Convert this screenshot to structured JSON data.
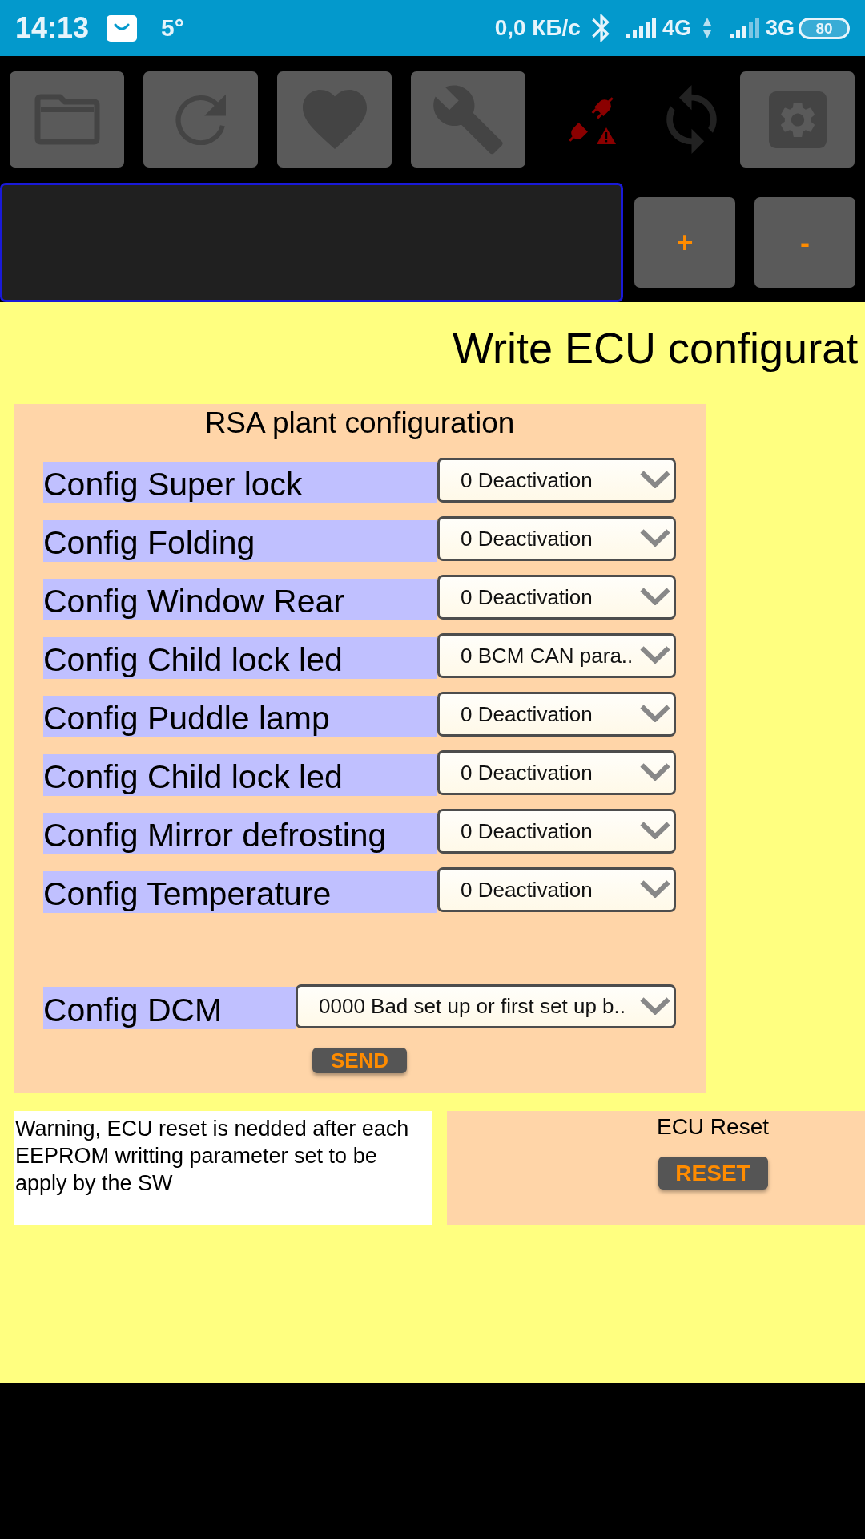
{
  "status_bar": {
    "time": "14:13",
    "temperature": "5°",
    "network_speed": "0,0 КБ/с",
    "network_1": "4G",
    "network_2": "3G",
    "battery": "80"
  },
  "toolbar": {
    "connected": false,
    "input": {
      "focused": true
    },
    "plus": "+",
    "minus": "-"
  },
  "title": "Write ECU configurat",
  "config_panel": {
    "title": "RSA plant configuration",
    "rows": [
      {
        "label": "Config Super lock",
        "value": "0 Deactivation"
      },
      {
        "label": "Config Folding",
        "value": "0 Deactivation"
      },
      {
        "label": "Config Window Rear",
        "value": "0 Deactivation"
      },
      {
        "label": "Config Child lock led",
        "value": "0 BCM CAN para.."
      },
      {
        "label": "Config Puddle lamp",
        "value": "0 Deactivation"
      },
      {
        "label": "Config Child lock led",
        "value": "0 Deactivation"
      },
      {
        "label": "Config Mirror defrosting",
        "value": "0 Deactivation"
      },
      {
        "label": "Config Temperature",
        "value": "0 Deactivation"
      }
    ],
    "dcm_row": {
      "label": "Config DCM",
      "value": "0000 Bad set up or first set up b.."
    },
    "send_button": "SEND"
  },
  "warning": "Warning, ECU reset is nedded after each EEPROM writting parameter set to be apply by the SW",
  "reset_panel": {
    "title": "ECU Reset",
    "button": "RESET"
  }
}
